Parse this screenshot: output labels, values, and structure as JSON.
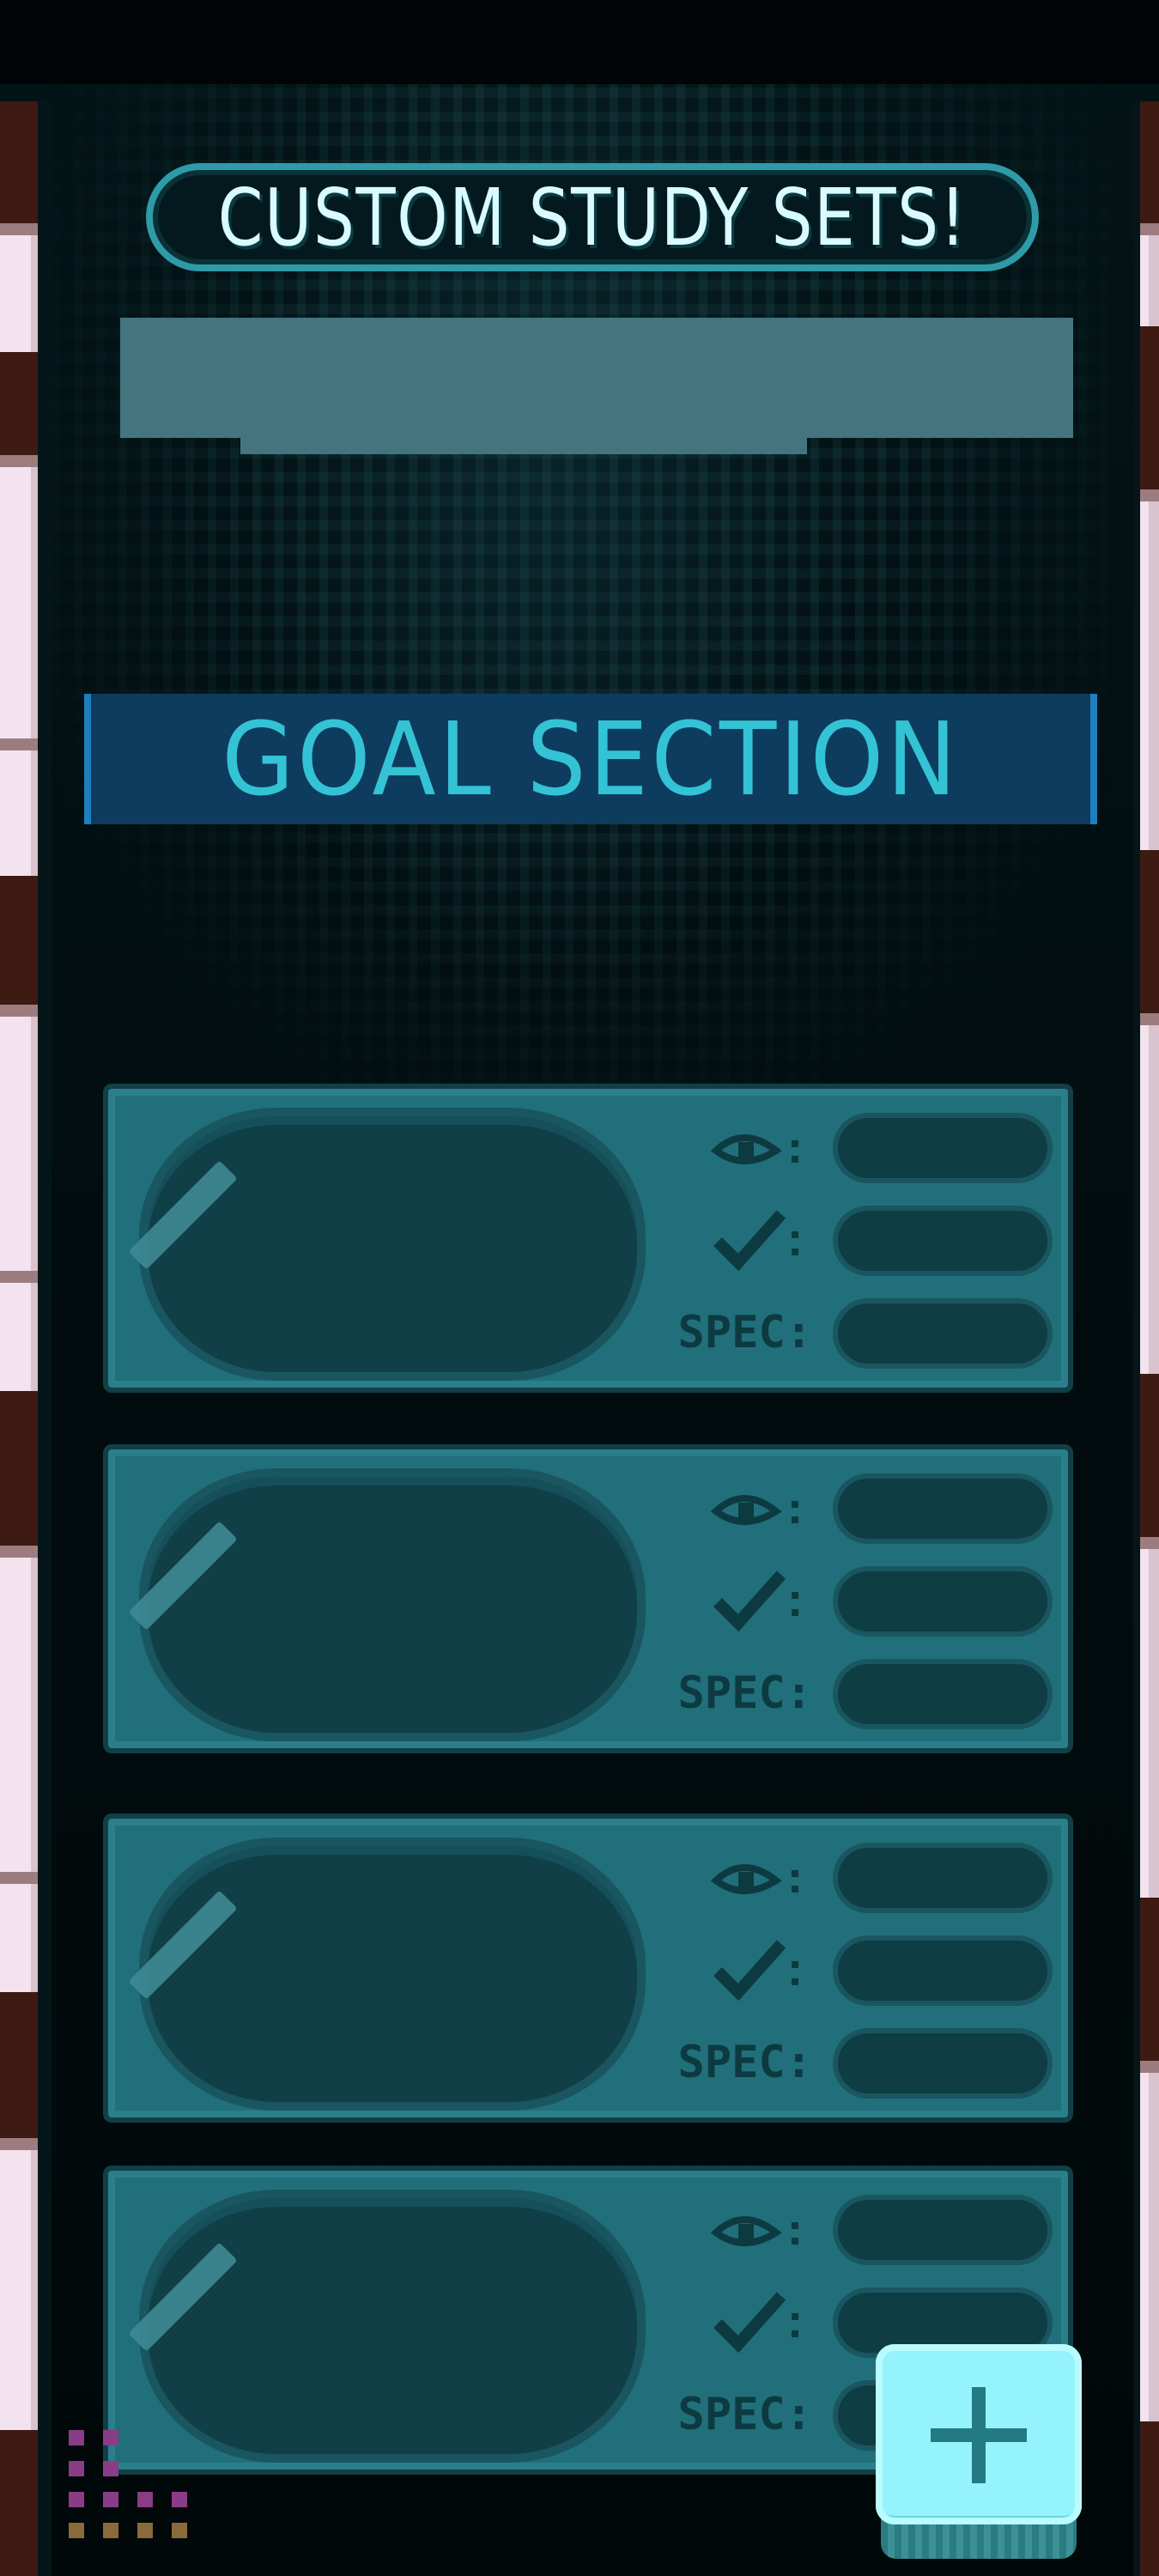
{
  "app": {
    "title": "CUSTOM STUDY SETS!"
  },
  "set_name_input": {
    "value": "",
    "placeholder": ""
  },
  "goal_section": {
    "label": "GOAL SECTION"
  },
  "cards": [
    {
      "view_value": "",
      "check_value": "",
      "spec_label": "SPEC",
      "spec_value": ""
    },
    {
      "view_value": "",
      "check_value": "",
      "spec_label": "SPEC",
      "spec_value": ""
    },
    {
      "view_value": "",
      "check_value": "",
      "spec_label": "SPEC",
      "spec_value": ""
    },
    {
      "view_value": "",
      "check_value": "",
      "spec_label": "SPEC",
      "spec_value": ""
    }
  ],
  "icons": {
    "view": "eye-icon",
    "check": "check-icon",
    "add": "plus-icon"
  },
  "colors": {
    "background": "#031417",
    "accent": "#34c3d4",
    "card": "#216f7a",
    "header": "#0d3c5f",
    "add_button": "#95f3fb"
  }
}
